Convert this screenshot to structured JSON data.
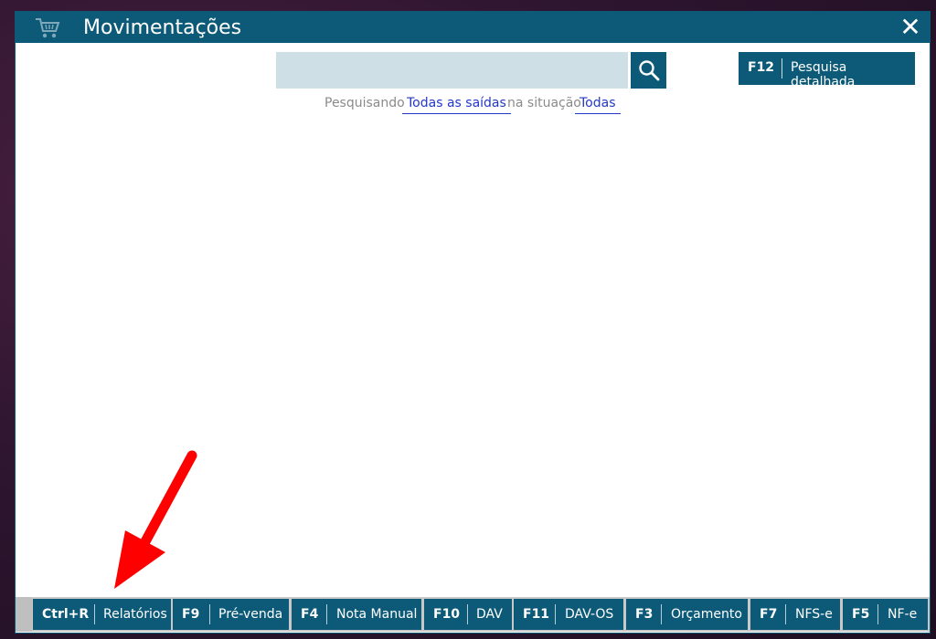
{
  "window": {
    "title": "Movimentações"
  },
  "icons": {
    "cart": "cart-icon",
    "close": "close-icon",
    "search": "search-icon",
    "arrow": "arrow-annotation"
  },
  "search": {
    "placeholder": "",
    "value": ""
  },
  "detailed_search": {
    "key": "F12",
    "label": "Pesquisa detalhada"
  },
  "filter": {
    "prefix": "Pesquisando",
    "type": "Todas as saídas",
    "middle": "na situação",
    "status": "Todas"
  },
  "footer": {
    "buttons": [
      {
        "key": "Ctrl+R",
        "label": "Relatórios"
      },
      {
        "key": "F9",
        "label": "Pré-venda"
      },
      {
        "key": "F4",
        "label": "Nota Manual"
      },
      {
        "key": "F10",
        "label": "DAV"
      },
      {
        "key": "F11",
        "label": "DAV-OS"
      },
      {
        "key": "F3",
        "label": "Orçamento"
      },
      {
        "key": "F7",
        "label": "NFS-e"
      },
      {
        "key": "F5",
        "label": "NF-e"
      }
    ]
  },
  "colors": {
    "accent": "#0d5a78",
    "link": "#2238c8",
    "search_bg": "#cfdfe6",
    "annotation": "#ff0000"
  }
}
